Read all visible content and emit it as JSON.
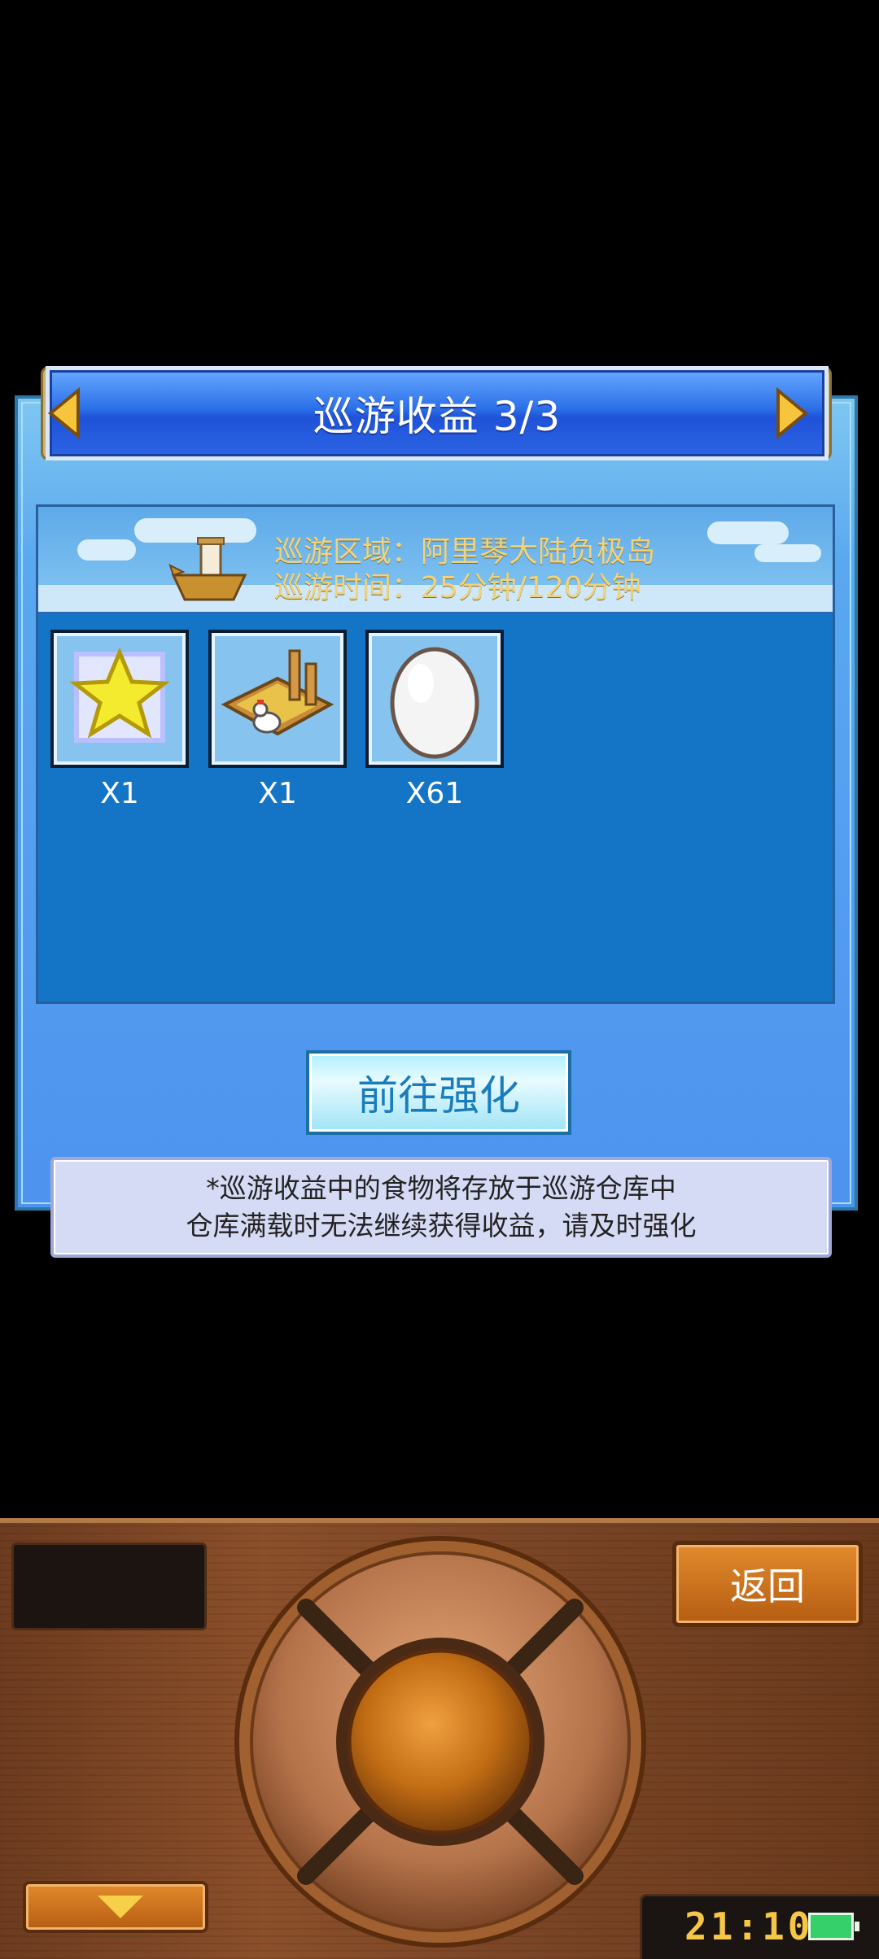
{
  "dialog": {
    "title": "巡游收益 3/3",
    "info": {
      "area": "巡游区域：阿里琴大陆负极岛",
      "time": "巡游时间：25分钟/120分钟"
    },
    "rewards": [
      {
        "icon": "star-icon",
        "count": "X1"
      },
      {
        "icon": "chicken-coop-icon",
        "count": "X1"
      },
      {
        "icon": "egg-icon",
        "count": "X61"
      }
    ],
    "upgrade_label": "前往强化",
    "notice_line1": "*巡游收益中的食物将存放于巡游仓库中",
    "notice_line2": "仓库满载时无法继续获得收益，请及时强化"
  },
  "controller": {
    "back_label": "返回",
    "clock": "21:10"
  },
  "colors": {
    "title_blue": "#2b6fe8",
    "panel_blue": "#1475c6",
    "info_gold": "#f0d37c",
    "wood": "#8b4f2a",
    "button_orange": "#e28a2c"
  }
}
